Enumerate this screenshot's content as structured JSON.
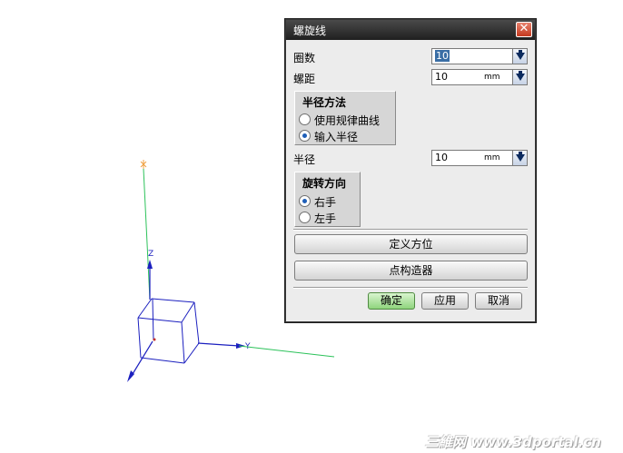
{
  "viewport": {
    "axes": {
      "z_label": "Z",
      "y_label": "Y"
    },
    "colors": {
      "blue": "#1b1fbf",
      "green": "#2cc25a",
      "orange": "#f0a040"
    }
  },
  "dialog": {
    "title": "螺旋线",
    "close_glyph": "✕",
    "turns": {
      "label": "圈数",
      "value": "10"
    },
    "pitch": {
      "label": "螺距",
      "value": "10",
      "unit": "mm"
    },
    "radius_method": {
      "title": "半径方法",
      "options": [
        "使用规律曲线",
        "输入半径"
      ],
      "selected": "输入半径"
    },
    "radius": {
      "label": "半径",
      "value": "10",
      "unit": "mm"
    },
    "direction": {
      "title": "旋转方向",
      "options": [
        "右手",
        "左手"
      ],
      "selected": "右手"
    },
    "define_orientation_label": "定义方位",
    "point_constructor_label": "点构造器",
    "buttons": {
      "ok": "确定",
      "apply": "应用",
      "cancel": "取消"
    }
  },
  "watermark": "三維网 www.3dportal.cn"
}
